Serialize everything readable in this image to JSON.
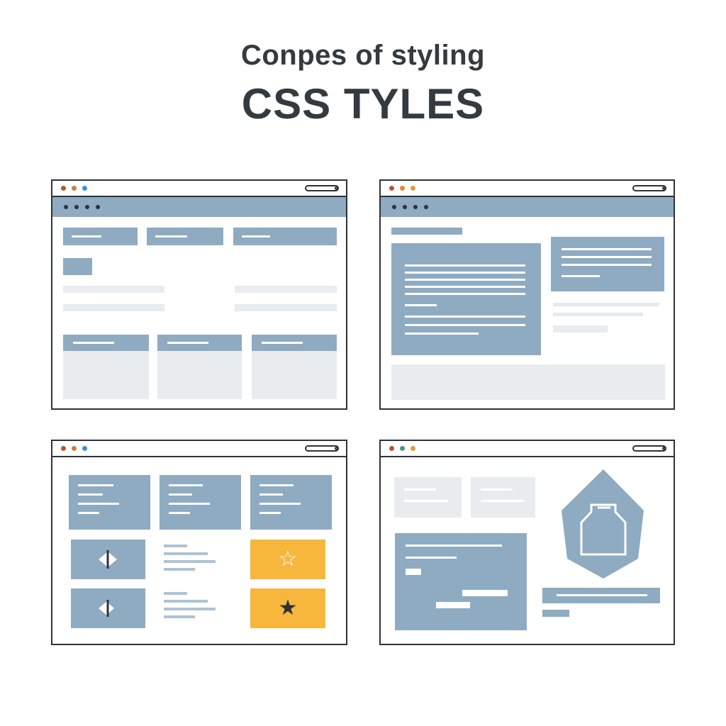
{
  "header": {
    "subtitle": "Conpes of styling",
    "title": "CSS TYLES"
  },
  "colors": {
    "accent_blue": "#8eabc1",
    "light_gray": "#e8ecee",
    "yellow": "#f6b73c",
    "frame": "#2e3238"
  },
  "icons": {
    "star_outline": "☆",
    "star_solid": "★",
    "arrows": "◀▶"
  }
}
